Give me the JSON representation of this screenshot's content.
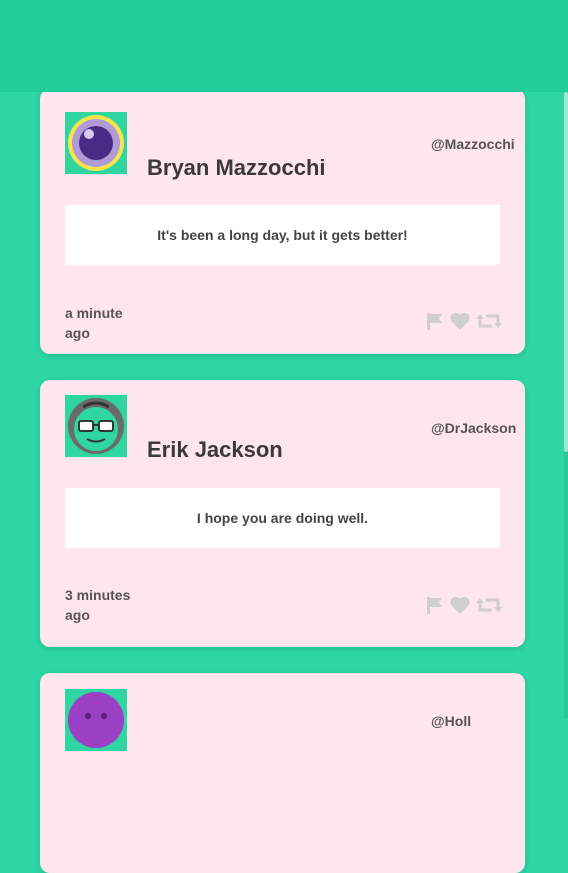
{
  "feed": {
    "posts": [
      {
        "name": "Bryan Mazzocchi",
        "handle": "@Mazzocchi",
        "message": "It's been a long day, but it gets better!",
        "time": "a minute ago",
        "avatar_icon": "purple-eye-face-icon"
      },
      {
        "name": "Erik Jackson",
        "handle": "@DrJackson",
        "message": "I hope you are doing well.",
        "time": "3 minutes ago",
        "avatar_icon": "glasses-face-icon"
      },
      {
        "name": "",
        "handle": "@Holl",
        "message": "",
        "time": "",
        "avatar_icon": "purple-face-icon"
      }
    ]
  },
  "colors": {
    "background": "#2dd6a3",
    "header": "#22cc96",
    "card": "#ffe6ee",
    "icon": "#cfcfcf"
  },
  "icons": {
    "flag": "flag-icon",
    "like": "heart-icon",
    "retweet": "retweet-icon"
  }
}
